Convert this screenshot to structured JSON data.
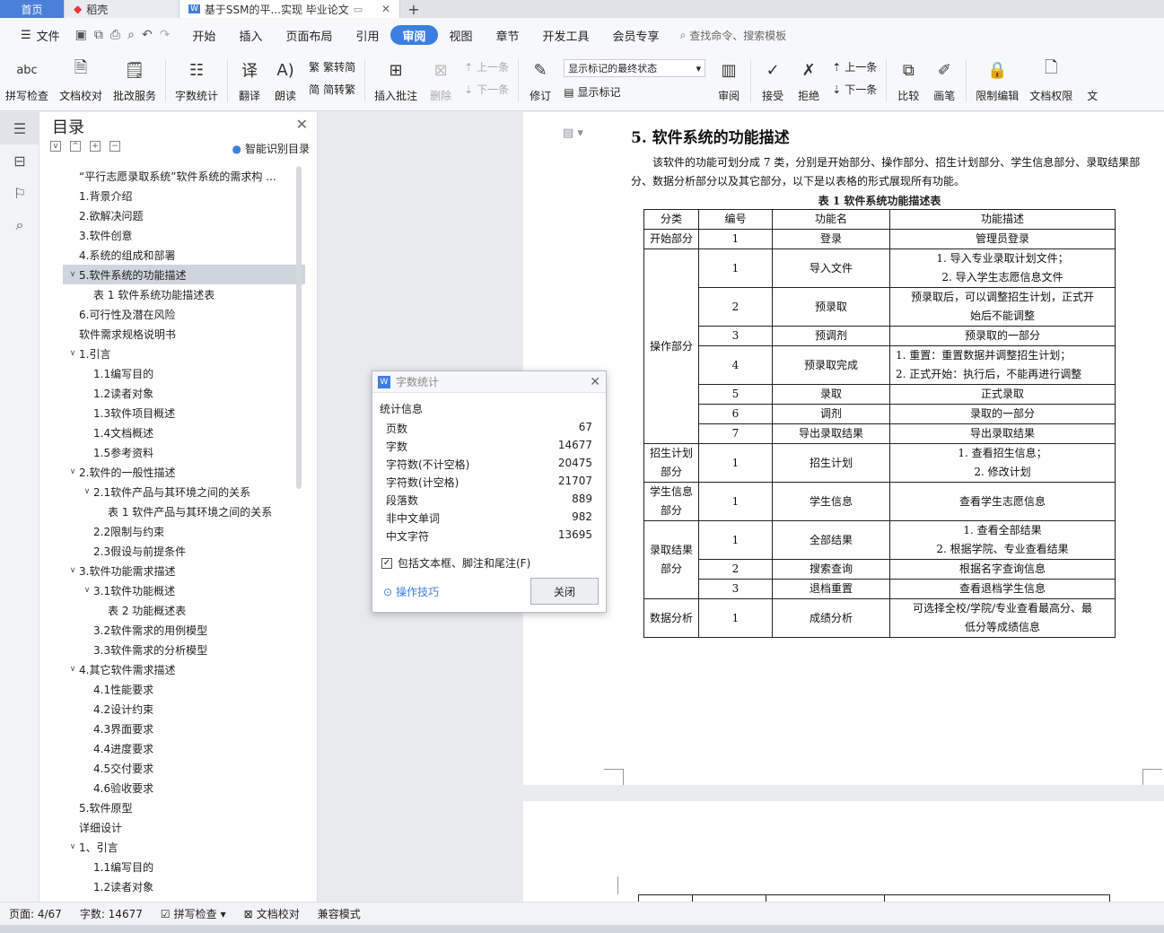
{
  "tabs": {
    "home": "首页",
    "daoke": "稻壳",
    "doc": "基于SSM的平...实现 毕业论文"
  },
  "menu": {
    "file": "文件",
    "items": [
      "开始",
      "插入",
      "页面布局",
      "引用",
      "审阅",
      "视图",
      "章节",
      "开发工具",
      "会员专享"
    ],
    "active_index": 4,
    "search": "查找命令、搜索模板"
  },
  "toolbar": {
    "spell": "拼写检查",
    "proof": "文档校对",
    "annotate_service": "批改服务",
    "word_count": "字数统计",
    "translate": "翻译",
    "read_aloud": "朗读",
    "to_traditional": "繁转简",
    "to_simplified": "简转繁",
    "insert_comment": "插入批注",
    "delete": "删除",
    "prev_comment": "上一条",
    "next_comment": "下一条",
    "revise": "修订",
    "markup_state": "显示标记的最终状态",
    "show_markup": "显示标记",
    "review": "审阅",
    "accept": "接受",
    "reject": "拒绝",
    "prev_change": "上一条",
    "next_change": "下一条",
    "compare": "比较",
    "pen": "画笔",
    "restrict_edit": "限制编辑",
    "doc_permission": "文档权限",
    "more": "文"
  },
  "nav": {
    "title": "目录",
    "smart_toc": "智能识别目录",
    "items": [
      {
        "text": "“平行志愿录取系统”软件系统的需求构 ...",
        "level": 1,
        "arrow": ""
      },
      {
        "text": "1.背景介绍",
        "level": 1,
        "arrow": ""
      },
      {
        "text": "2.欲解决问题",
        "level": 1,
        "arrow": ""
      },
      {
        "text": "3.软件创意",
        "level": 1,
        "arrow": ""
      },
      {
        "text": "4.系统的组成和部署",
        "level": 1,
        "arrow": ""
      },
      {
        "text": "5.软件系统的功能描述",
        "level": 1,
        "arrow": "v",
        "selected": true
      },
      {
        "text": "表 1 软件系统功能描述表",
        "level": 2,
        "arrow": ""
      },
      {
        "text": "6.可行性及潜在风险",
        "level": 1,
        "arrow": ""
      },
      {
        "text": "软件需求规格说明书",
        "level": 1,
        "arrow": ""
      },
      {
        "text": "1.引言",
        "level": 1,
        "arrow": "v"
      },
      {
        "text": "1.1编写目的",
        "level": 2,
        "arrow": ""
      },
      {
        "text": "1.2读者对象",
        "level": 2,
        "arrow": ""
      },
      {
        "text": "1.3软件项目概述",
        "level": 2,
        "arrow": ""
      },
      {
        "text": "1.4文档概述",
        "level": 2,
        "arrow": ""
      },
      {
        "text": "1.5参考资料",
        "level": 2,
        "arrow": ""
      },
      {
        "text": "2.软件的一般性描述",
        "level": 1,
        "arrow": "v"
      },
      {
        "text": "2.1软件产品与其环境之间的关系",
        "level": 2,
        "arrow": "v"
      },
      {
        "text": "表 1 软件产品与其环境之间的关系",
        "level": 3,
        "arrow": ""
      },
      {
        "text": "2.2限制与约束",
        "level": 2,
        "arrow": ""
      },
      {
        "text": "2.3假设与前提条件",
        "level": 2,
        "arrow": ""
      },
      {
        "text": "3.软件功能需求描述",
        "level": 1,
        "arrow": "v"
      },
      {
        "text": "3.1软件功能概述",
        "level": 2,
        "arrow": "v"
      },
      {
        "text": "表 2 功能概述表",
        "level": 3,
        "arrow": ""
      },
      {
        "text": "3.2软件需求的用例模型",
        "level": 2,
        "arrow": ""
      },
      {
        "text": "3.3软件需求的分析模型",
        "level": 2,
        "arrow": ""
      },
      {
        "text": "4.其它软件需求描述",
        "level": 1,
        "arrow": "v"
      },
      {
        "text": "4.1性能要求",
        "level": 2,
        "arrow": ""
      },
      {
        "text": "4.2设计约束",
        "level": 2,
        "arrow": ""
      },
      {
        "text": "4.3界面要求",
        "level": 2,
        "arrow": ""
      },
      {
        "text": "4.4进度要求",
        "level": 2,
        "arrow": ""
      },
      {
        "text": "4.5交付要求",
        "level": 2,
        "arrow": ""
      },
      {
        "text": "4.6验收要求",
        "level": 2,
        "arrow": ""
      },
      {
        "text": "5.软件原型",
        "level": 1,
        "arrow": ""
      },
      {
        "text": "详细设计",
        "level": 1,
        "arrow": ""
      },
      {
        "text": "1、引言",
        "level": 1,
        "arrow": "v"
      },
      {
        "text": "1.1编写目的",
        "level": 2,
        "arrow": ""
      },
      {
        "text": "1.2读者对象",
        "level": 2,
        "arrow": ""
      }
    ]
  },
  "doc": {
    "heading": "5. 软件系统的功能描述",
    "paragraph": "该软件的功能可划分成 7 类，分别是开始部分、操作部分、招生计划部分、学生信息部分、录取结果部分、数据分析部分以及其它部分，以下是以表格的形式展现所有功能。",
    "table_caption": "表 1 软件系统功能描述表",
    "headers": [
      "分类",
      "编号",
      "功能名",
      "功能描述"
    ],
    "rows": [
      {
        "cat": "开始部分",
        "span": 1,
        "num": "1",
        "name": "登录",
        "desc": [
          "管理员登录"
        ],
        "left": false
      },
      {
        "cat": "操作部分",
        "span": 7,
        "num": "1",
        "name": "导入文件",
        "desc": [
          "1.  导入专业录取计划文件；",
          "2.  导入学生志愿信息文件"
        ],
        "left": false
      },
      {
        "num": "2",
        "name": "预录取",
        "desc": [
          "预录取后，可以调整招生计划，正式开",
          "始后不能调整"
        ],
        "left": false
      },
      {
        "num": "3",
        "name": "预调剂",
        "desc": [
          "预录取的一部分"
        ],
        "left": false
      },
      {
        "num": "4",
        "name": "预录取完成",
        "desc": [
          "1.  重置：重置数据并调整招生计划；",
          "2.  正式开始：执行后，不能再进行调整"
        ],
        "left": true
      },
      {
        "num": "5",
        "name": "录取",
        "desc": [
          "正式录取"
        ],
        "left": false
      },
      {
        "num": "6",
        "name": "调剂",
        "desc": [
          "录取的一部分"
        ],
        "left": false
      },
      {
        "num": "7",
        "name": "导出录取结果",
        "desc": [
          "导出录取结果"
        ],
        "left": false
      },
      {
        "cat": "招生计划部分",
        "span": 1,
        "num": "1",
        "name": "招生计划",
        "desc": [
          "1.  查看招生信息；",
          "2.  修改计划"
        ],
        "left": false
      },
      {
        "cat": "学生信息部分",
        "span": 1,
        "num": "1",
        "name": "学生信息",
        "desc": [
          "查看学生志愿信息"
        ],
        "left": false
      },
      {
        "cat": "录取结果部分",
        "span": 3,
        "num": "1",
        "name": "全部结果",
        "desc": [
          "1.  查看全部结果",
          "2.  根据学院、专业查看结果"
        ],
        "left": false
      },
      {
        "num": "2",
        "name": "搜索查询",
        "desc": [
          "根据名字查询信息"
        ],
        "left": false
      },
      {
        "num": "3",
        "name": "退档重置",
        "desc": [
          "查看退档学生信息"
        ],
        "left": false
      },
      {
        "cat": "数据分析",
        "span": 1,
        "num": "1",
        "name": "成绩分析",
        "desc": [
          "可选择全校/学院/专业查看最高分、最",
          "低分等成绩信息"
        ],
        "left": false
      }
    ]
  },
  "dialog": {
    "title": "字数统计",
    "section": "统计信息",
    "stats": [
      {
        "label": "页数",
        "value": "67"
      },
      {
        "label": "字数",
        "value": "14677"
      },
      {
        "label": "字符数(不计空格)",
        "value": "20475"
      },
      {
        "label": "字符数(计空格)",
        "value": "21707"
      },
      {
        "label": "段落数",
        "value": "889"
      },
      {
        "label": "非中文单词",
        "value": "982"
      },
      {
        "label": "中文字符",
        "value": "13695"
      }
    ],
    "include_label": "包括文本框、脚注和尾注(F)",
    "include_checked": true,
    "tips": "操作技巧",
    "close": "关闭"
  },
  "status": {
    "page": "页面: 4/67",
    "words": "字数: 14677",
    "spell": "拼写检查",
    "proof": "文档校对",
    "compat": "兼容模式"
  },
  "colors": {
    "accent": "#3d7fe0",
    "home_tab": "#4a80d8",
    "selected_nav": "#cfd5dd"
  }
}
